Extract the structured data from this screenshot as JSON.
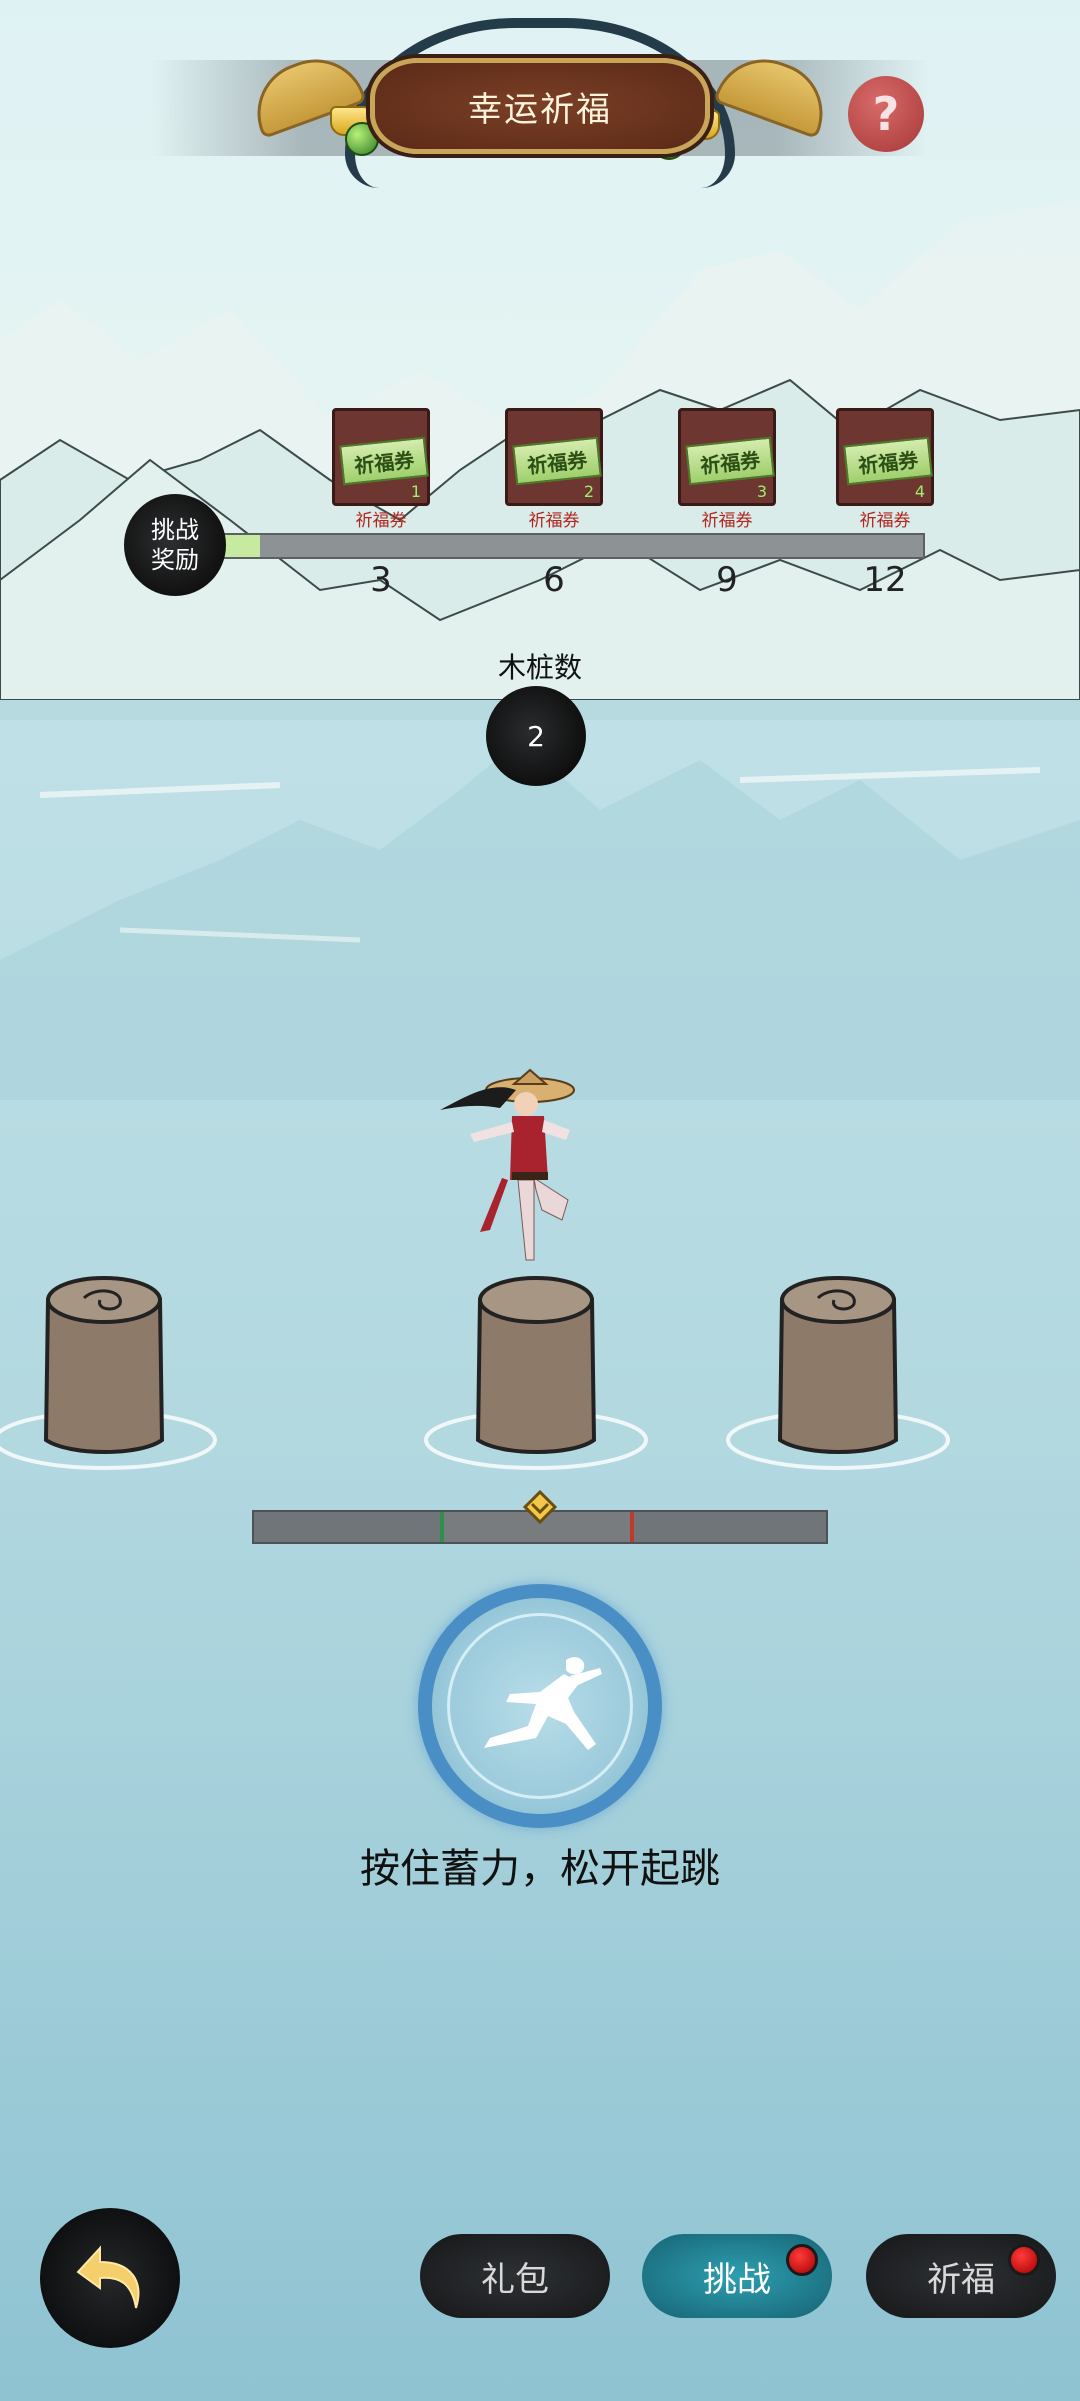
{
  "header": {
    "title": "幸运祈福",
    "help_symbol": "?"
  },
  "rewards": {
    "badge_line1": "挑战",
    "badge_line2": "奖励",
    "progress_fraction": 0.08,
    "items": [
      {
        "ticket_text": "祈福券",
        "count": "1",
        "label": "祈福券",
        "threshold": "3"
      },
      {
        "ticket_text": "祈福券",
        "count": "2",
        "label": "祈福券",
        "threshold": "6"
      },
      {
        "ticket_text": "祈福券",
        "count": "3",
        "label": "祈福券",
        "threshold": "9"
      },
      {
        "ticket_text": "祈福券",
        "count": "4",
        "label": "祈福券",
        "threshold": "12"
      }
    ]
  },
  "stumps": {
    "label": "木桩数",
    "count": "2"
  },
  "jump": {
    "hint": "按住蓄力，松开起跳"
  },
  "nav": {
    "back_icon": "back-arrow-icon",
    "tabs": [
      {
        "label": "礼包",
        "active": false,
        "badge": false
      },
      {
        "label": "挑战",
        "active": true,
        "badge": true
      },
      {
        "label": "祈福",
        "active": false,
        "badge": true
      }
    ]
  },
  "colors": {
    "accent_active": "#2d9fb0",
    "reward_fill": "#c7eaa1",
    "badge_red": "#e02020",
    "jump_ring": "#4a8ec6"
  }
}
